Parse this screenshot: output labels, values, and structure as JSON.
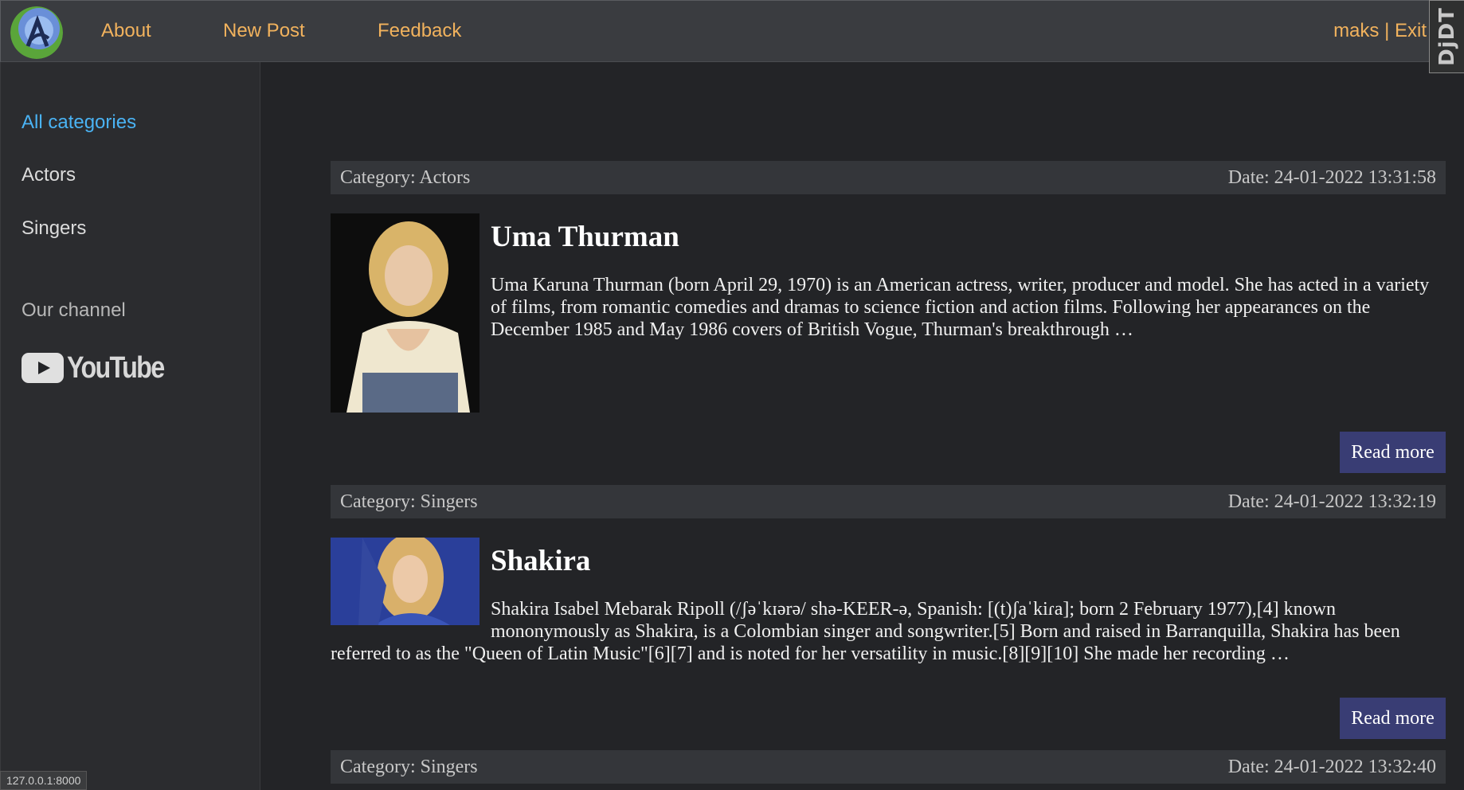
{
  "header": {
    "nav": [
      "About",
      "New Post",
      "Feedback"
    ],
    "user": "maks",
    "separator": "|",
    "exit": "Exit",
    "debug_toolbar": "DjDT"
  },
  "sidebar": {
    "categories": [
      "All categories",
      "Actors",
      "Singers"
    ],
    "channel_label": "Our channel",
    "youtube_label": "YouTube",
    "status_url": "127.0.0.1:8000"
  },
  "posts": [
    {
      "category": "Category: Actors",
      "date": "Date: 24-01-2022 13:31:58",
      "title": "Uma Thurman",
      "text": "Uma Karuna Thurman (born April 29, 1970) is an American actress, writer, producer and model. She has acted in a variety of films, from romantic comedies and dramas to science fiction and action films. Following her appearances on the December 1985 and May 1986 covers of British Vogue, Thurman's breakthrough …",
      "read_more": "Read more"
    },
    {
      "category": "Category: Singers",
      "date": "Date: 24-01-2022 13:32:19",
      "title": "Shakira",
      "text": "Shakira Isabel Mebarak Ripoll (/ʃəˈkɪərə/ shə-KEER-ə, Spanish: [(t)ʃaˈkiɾa]; born 2 February 1977),[4] known mononymously as Shakira, is a Colombian singer and songwriter.[5] Born and raised in Barranquilla, Shakira has been referred to as the \"Queen of Latin Music\"[6][7] and is noted for her versatility in music.[8][9][10] She made her recording …",
      "read_more": "Read more"
    },
    {
      "category": "Category: Singers",
      "date": "Date: 24-01-2022 13:32:40"
    }
  ],
  "colors": {
    "accent_nav": "#f1b25d",
    "active_category": "#4ab3f4",
    "button_bg": "#393d74"
  }
}
